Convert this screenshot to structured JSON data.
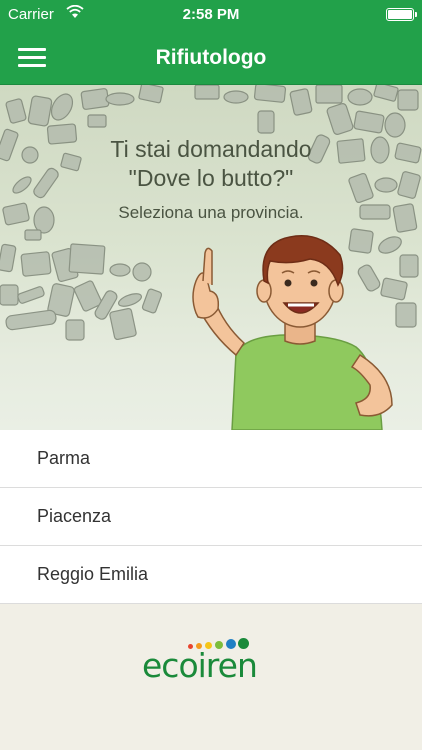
{
  "status_bar": {
    "carrier": "Carrier",
    "time": "2:58 PM"
  },
  "nav": {
    "title": "Rifiutologo"
  },
  "hero": {
    "title_line1": "Ti stai domandando",
    "title_line2": "\"Dove lo butto?\"",
    "subtitle": "Seleziona una provincia."
  },
  "provinces": [
    "Parma",
    "Piacenza",
    "Reggio Emilia"
  ],
  "footer": {
    "logo_text": "ecoiren"
  },
  "colors": {
    "primary": "#22a14a",
    "logo_green": "#1a8a3a"
  }
}
